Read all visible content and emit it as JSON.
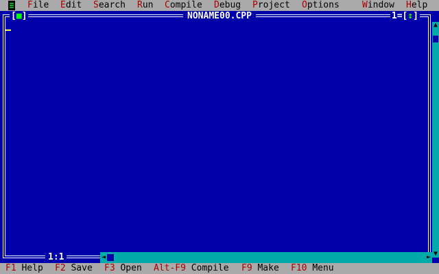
{
  "menu": {
    "items": [
      {
        "hot": "F",
        "rest": "ile"
      },
      {
        "hot": "E",
        "rest": "dit"
      },
      {
        "hot": "S",
        "rest": "earch"
      },
      {
        "hot": "R",
        "rest": "un"
      },
      {
        "hot": "C",
        "rest": "ompile"
      },
      {
        "hot": "D",
        "rest": "ebug"
      },
      {
        "hot": "P",
        "rest": "roject"
      },
      {
        "hot": "O",
        "rest": "ptions"
      },
      {
        "hot": "W",
        "rest": "indow"
      },
      {
        "hot": "H",
        "rest": "elp"
      }
    ]
  },
  "window": {
    "title": "NONAME00.CPP",
    "close_glyph": "■",
    "number": "1",
    "zoom_glyph": "↕",
    "position": "1:1"
  },
  "statusbar": {
    "hints": [
      {
        "key": "F1",
        "label": "Help"
      },
      {
        "key": "F2",
        "label": "Save"
      },
      {
        "key": "F3",
        "label": "Open"
      },
      {
        "key": "Alt-F9",
        "label": "Compile"
      },
      {
        "key": "F9",
        "label": "Make"
      },
      {
        "key": "F10",
        "label": "Menu"
      }
    ]
  },
  "colors": {
    "desktop": "#0000aa",
    "menu_bg": "#aaaaaa",
    "hotkey": "#aa0000",
    "frame": "#ffffff",
    "scrollbar": "#00aaaa",
    "active_glyph": "#00ff00"
  }
}
